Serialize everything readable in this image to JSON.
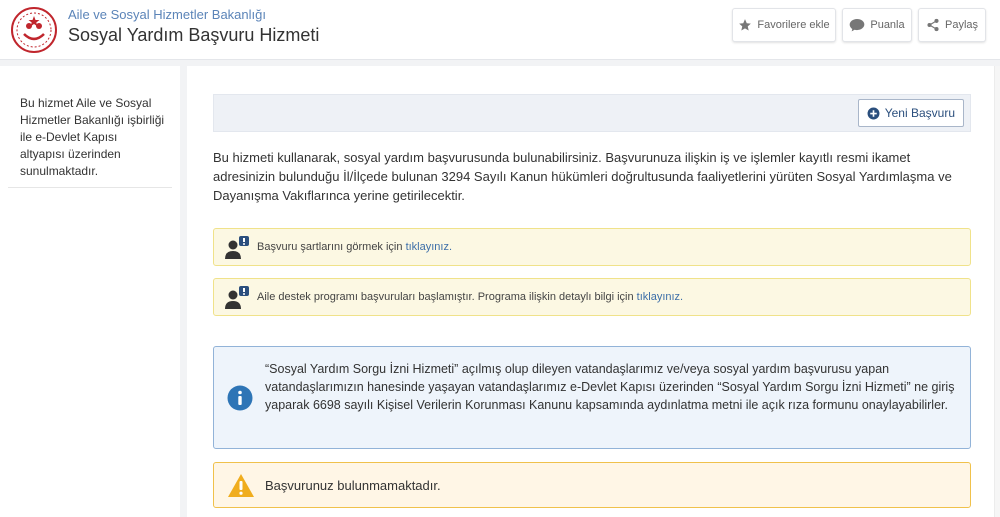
{
  "header": {
    "ministry": "Aile ve Sosyal Hizmetler Bakanlığı",
    "service_title": "Sosyal Yardım Başvuru Hizmeti",
    "favorites_label": "Favorilere ekle",
    "rate_label": "Puanla",
    "share_label": "Paylaş"
  },
  "sidebar": {
    "info_text": "Bu hizmet Aile ve Sosyal Hizmetler Bakanlığı işbirliği ile e-Devlet Kapısı altyapısı üzerinden sunulmaktadır."
  },
  "main": {
    "new_application_label": "Yeni Başvuru",
    "intro_text": "Bu hizmeti kullanarak, sosyal yardım başvurusunda bulunabilirsiniz. Başvurunuza ilişkin iş ve işlemler kayıtlı resmi ikamet adresinizin bulunduğu İl/İlçede bulunan 3294 Sayılı Kanun hükümleri doğrultusunda faaliyetlerini yürüten Sosyal Yardımlaşma ve Dayanışma Vakıflarınca yerine getirilecektir.",
    "notice1_text": "Başvuru şartlarını görmek için ",
    "notice1_link": "tıklayınız.",
    "notice2_text": "Aile destek programı başvuruları başlamıştır. Programa ilişkin detaylı bilgi için ",
    "notice2_link": "tıklayınız.",
    "info_text": "“Sosyal Yardım Sorgu İzni Hizmeti” açılmış olup dileyen vatandaşlarımız ve/veya sosyal yardım başvurusu yapan vatandaşlarımızın hanesinde yaşayan vatandaşlarımız e-Devlet Kapısı üzerinden “Sosyal Yardım Sorgu İzni Hizmeti” ne giriş yaparak 6698 sayılı Kişisel Verilerin Korunması Kanunu kapsamında aydınlatma metni ile açık rıza formunu onaylayabilirler.",
    "alert_text": "Başvurunuz bulunmamaktadır."
  },
  "colors": {
    "accent": "#3c6ea8",
    "logo_red": "#c0262d",
    "warning_bg": "#fcf8e3",
    "info_bg": "#eef4fb",
    "alert_icon": "#f0ad1e"
  },
  "icons": {
    "logo": "ministry-logo-icon",
    "favorites": "star-icon",
    "rate": "speech-bubble-icon",
    "share": "share-icon",
    "new_application": "plus-circle-icon",
    "notice": "person-alert-icon",
    "info": "info-circle-icon",
    "alert": "warning-triangle-icon"
  }
}
